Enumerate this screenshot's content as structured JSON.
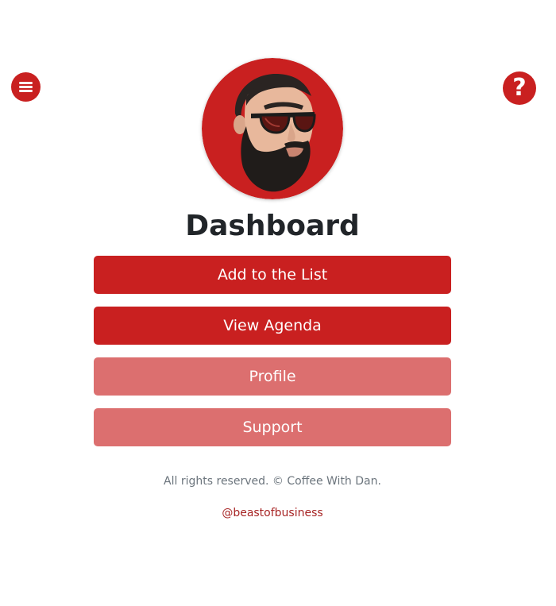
{
  "header": {
    "menu_icon": "hamburger-menu-icon",
    "help_icon": "question-mark-icon",
    "help_glyph": "?"
  },
  "avatar": {
    "icon": "bearded-man-sunglasses-avatar"
  },
  "main": {
    "title": "Dashboard",
    "buttons": [
      {
        "label": "Add to the List"
      },
      {
        "label": "View Agenda"
      },
      {
        "label": "Profile"
      },
      {
        "label": "Support"
      }
    ]
  },
  "footer": {
    "copyright": "All rights reserved. © Coffee With Dan.",
    "handle": "@beastofbusiness"
  },
  "colors": {
    "primary": "#c92020",
    "primary_light": "#dc6f6f",
    "heading": "#212529",
    "muted": "#6c757d",
    "link": "#a72424"
  }
}
